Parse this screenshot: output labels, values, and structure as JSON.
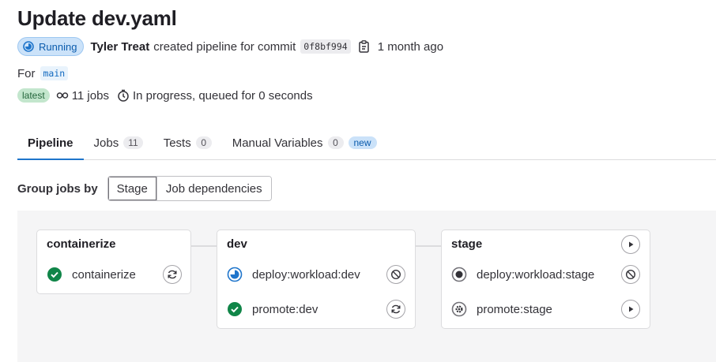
{
  "pipeline": {
    "title": "Update dev.yaml",
    "status": "Running",
    "author": "Tyler Treat",
    "created_text": "created pipeline for commit",
    "commit_sha": "0f8bf994",
    "time_ago": "1 month ago",
    "for_label": "For",
    "branch": "main",
    "latest_badge": "latest",
    "jobs_count": "11 jobs",
    "progress_text": "In progress, queued for 0 seconds"
  },
  "tabs": [
    {
      "label": "Pipeline",
      "active": true
    },
    {
      "label": "Jobs",
      "count": "11"
    },
    {
      "label": "Tests",
      "count": "0"
    },
    {
      "label": "Manual Variables",
      "count": "0",
      "badge": "new"
    }
  ],
  "grouping": {
    "label": "Group jobs by",
    "options": [
      "Stage",
      "Job dependencies"
    ],
    "selected": "Stage"
  },
  "stages": [
    {
      "name": "containerize",
      "jobs": [
        {
          "name": "containerize",
          "status": "success",
          "action": "retry"
        }
      ]
    },
    {
      "name": "dev",
      "jobs": [
        {
          "name": "deploy:workload:dev",
          "status": "running",
          "action": "cancel"
        },
        {
          "name": "promote:dev",
          "status": "success",
          "action": "retry"
        }
      ]
    },
    {
      "name": "stage",
      "stage_action": "play",
      "jobs": [
        {
          "name": "deploy:workload:stage",
          "status": "created",
          "action": "cancel"
        },
        {
          "name": "promote:stage",
          "status": "manual",
          "action": "play"
        }
      ]
    }
  ],
  "colors": {
    "success": "#108548",
    "running": "#1f75cb",
    "created": "#737278",
    "manual": "#737278",
    "tab_active": "#1f75cb"
  }
}
